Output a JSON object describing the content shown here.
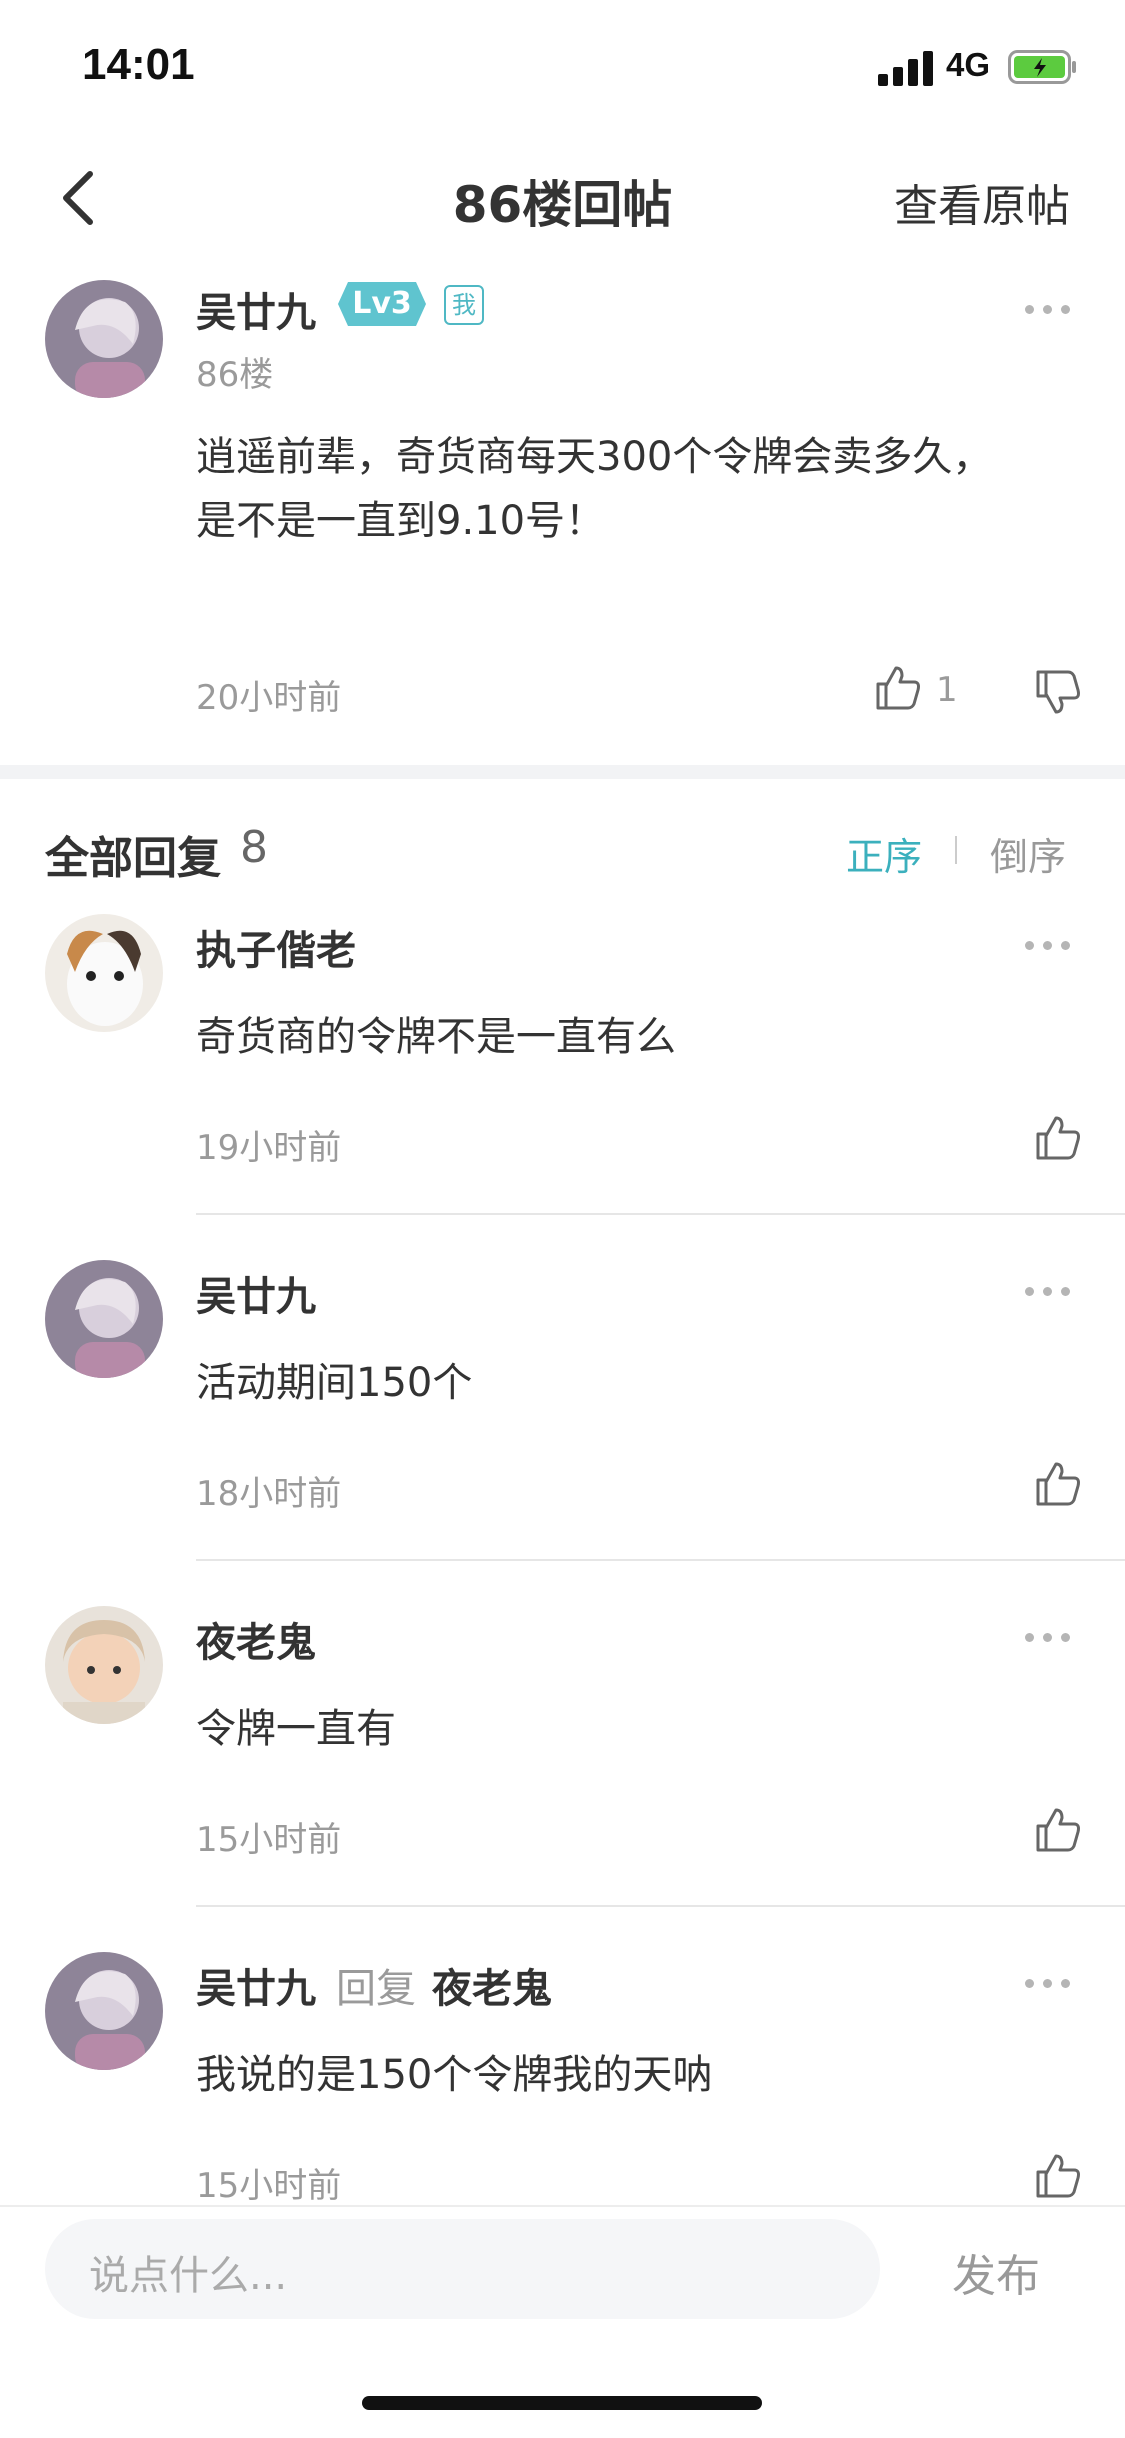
{
  "status_bar": {
    "time": "14:01",
    "network": "4G"
  },
  "header": {
    "title": "86楼回帖",
    "view_original": "查看原帖"
  },
  "post": {
    "author": "吴廿九",
    "level": "Lv3",
    "me_badge": "我",
    "floor": "86楼",
    "content_line1": "逍遥前辈，奇货商每天300个令牌会卖多久，",
    "content_line2": "是不是一直到9.10号！",
    "time": "20小时前",
    "likes": "1"
  },
  "replies_header": {
    "label": "全部回复",
    "count": "8",
    "sort_asc": "正序",
    "sort_desc": "倒序"
  },
  "replies": [
    {
      "author": "执子偕老",
      "content": "奇货商的令牌不是一直有么",
      "time": "19小时前"
    },
    {
      "author": "吴廿九",
      "content": "活动期间150个",
      "time": "18小时前"
    },
    {
      "author": "夜老鬼",
      "content": "令牌一直有",
      "time": "15小时前"
    },
    {
      "author": "吴廿九",
      "reply_word": "回复",
      "reply_to": "夜老鬼",
      "content": "我说的是150个令牌我的天呐",
      "time": "15小时前"
    }
  ],
  "composer": {
    "placeholder": "说点什么...",
    "publish": "发布"
  },
  "colors": {
    "accent": "#3bb0bd",
    "level_badge": "#5fc4cf"
  }
}
